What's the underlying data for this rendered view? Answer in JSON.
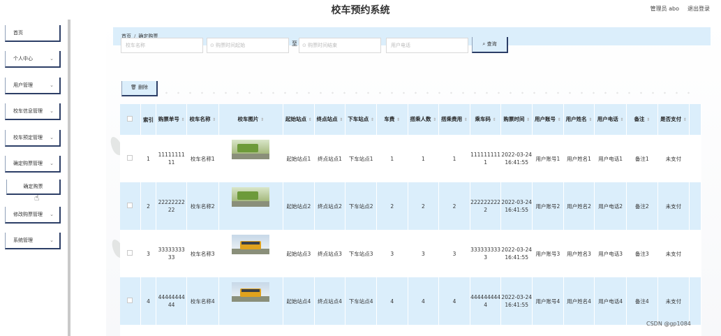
{
  "header": {
    "title": "校车预约系统",
    "user_label": "管理员 abo",
    "logout_label": "退出登录"
  },
  "sidebar": {
    "items": [
      {
        "label": "首页",
        "chevron": ""
      },
      {
        "label": "个人中心",
        "chevron": "⌄"
      },
      {
        "label": "用户管理",
        "chevron": "⌄"
      },
      {
        "label": "校车信息管理",
        "chevron": "⌄"
      },
      {
        "label": "校车预定管理",
        "chevron": "⌄"
      },
      {
        "label": "确定购票管理",
        "chevron": "⌄"
      },
      {
        "label": "确定购票",
        "chevron": ""
      },
      {
        "label": "修改购票管理",
        "chevron": "⌄"
      },
      {
        "label": "系统管理",
        "chevron": "⌄"
      }
    ]
  },
  "breadcrumb": {
    "home": "首页",
    "separator": "/",
    "current": "确定购票"
  },
  "search": {
    "bus_name_placeholder": "校车名称",
    "time_start_placeholder": "⊙ 购票时间起始",
    "to_label": "至",
    "time_end_placeholder": "⊙ 购票时间结束",
    "phone_placeholder": "用户电话",
    "search_button": "⌕ 查询"
  },
  "toolbar": {
    "delete_button": "🗑 删除"
  },
  "table": {
    "headers": [
      "索引",
      "购票单号",
      "校车名称",
      "校车图片",
      "起始站点",
      "终点站点",
      "下车站点",
      "车费",
      "搭乘人数",
      "搭乘费用",
      "乘车码",
      "购票时间",
      "用户账号",
      "用户姓名",
      "用户电话",
      "备注",
      "是否支付"
    ],
    "sort_glyph": "⇕",
    "rows": [
      {
        "index": "1",
        "order": "1111111111",
        "bus": "校车名称1",
        "start": "起始站点1",
        "end": "终点站点1",
        "off": "下车站点1",
        "fare": "1",
        "riders": "1",
        "cost": "1",
        "code": "1111111111",
        "time": "2022-03-24 16:41:55",
        "account": "用户账号1",
        "name": "用户姓名1",
        "phone": "用户电话1",
        "note": "备注1",
        "paid": "未支付",
        "image": "bus-green-top"
      },
      {
        "index": "2",
        "order": "2222222222",
        "bus": "校车名称2",
        "start": "起始站点2",
        "end": "终点站点2",
        "off": "下车站点2",
        "fare": "2",
        "riders": "2",
        "cost": "2",
        "code": "2222222222",
        "time": "2022-03-24 16:41:55",
        "account": "用户账号2",
        "name": "用户姓名2",
        "phone": "用户电话2",
        "note": "备注2",
        "paid": "未支付",
        "image": "bus-green"
      },
      {
        "index": "3",
        "order": "3333333333",
        "bus": "校车名称3",
        "start": "起始站点3",
        "end": "终点站点3",
        "off": "下车站点3",
        "fare": "3",
        "riders": "3",
        "cost": "3",
        "code": "3333333333",
        "time": "2022-03-24 16:41:55",
        "account": "用户账号3",
        "name": "用户姓名3",
        "phone": "用户电话3",
        "note": "备注3",
        "paid": "未支付",
        "image": "bus-yellow"
      },
      {
        "index": "4",
        "order": "4444444444",
        "bus": "校车名称4",
        "start": "起始站点4",
        "end": "终点站点4",
        "off": "下车站点4",
        "fare": "4",
        "riders": "4",
        "cost": "4",
        "code": "4444444444",
        "time": "2022-03-24 16:41:55",
        "account": "用户账号4",
        "name": "用户姓名4",
        "phone": "用户电话4",
        "note": "备注4",
        "paid": "未支付",
        "image": "bus-yellow"
      }
    ]
  },
  "watermark": "CSDN @gp1084",
  "colors": {
    "accent": "#dbeefb",
    "border_dark": "#2c3e66",
    "sidebar_rule": "#c9c9c9"
  }
}
